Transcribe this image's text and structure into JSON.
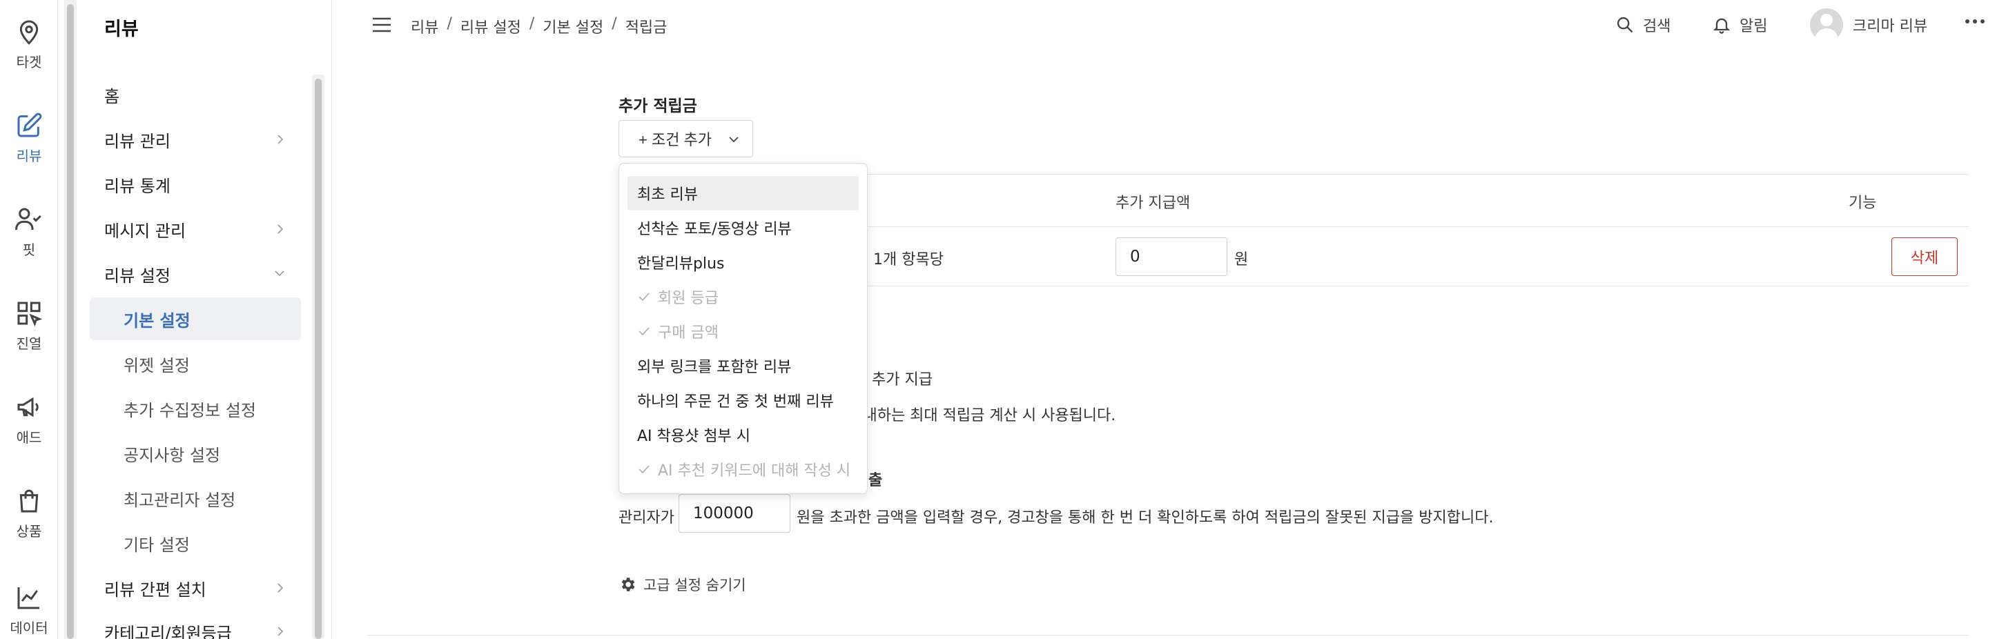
{
  "app": {
    "title": "리뷰"
  },
  "rail": {
    "items": [
      {
        "name": "target",
        "label": "타겟",
        "icon": "location-pin-icon"
      },
      {
        "name": "review",
        "label": "리뷰",
        "icon": "edit-icon",
        "active": true
      },
      {
        "name": "fit",
        "label": "핏",
        "icon": "user-check-icon"
      },
      {
        "name": "display",
        "label": "진열",
        "icon": "grid-cursor-icon"
      },
      {
        "name": "ad",
        "label": "애드",
        "icon": "megaphone-icon"
      },
      {
        "name": "product",
        "label": "상품",
        "icon": "shopping-bag-icon"
      },
      {
        "name": "data",
        "label": "데이터",
        "icon": "chart-line-icon"
      }
    ]
  },
  "menu": {
    "title": "리뷰",
    "items": [
      {
        "label": "홈"
      },
      {
        "label": "리뷰 관리"
      },
      {
        "label": "리뷰 통계"
      },
      {
        "label": "메시지 관리"
      },
      {
        "label": "리뷰 설정"
      },
      {
        "label": "기본 설정"
      },
      {
        "label": "위젯 설정"
      },
      {
        "label": "추가 수집정보 설정"
      },
      {
        "label": "공지사항 설정"
      },
      {
        "label": "최고관리자 설정"
      },
      {
        "label": "기타 설정"
      },
      {
        "label": "리뷰 간편 설치"
      },
      {
        "label": "카테고리/회원등급"
      }
    ]
  },
  "header": {
    "breadcrumb": [
      "리뷰",
      "리뷰 설정",
      "기본 설정",
      "적립금"
    ],
    "search_label": "검색",
    "alarm_label": "알림",
    "user_label": "크리마 리뷰"
  },
  "main": {
    "section_title": "추가 적립금",
    "add_condition_label": "+ 조건 추가",
    "table": {
      "headers": {
        "amount": "추가 지급액",
        "action": "기능"
      },
      "row": {
        "unit_text": "1개 항목당",
        "amount_value": "0",
        "currency": "원",
        "delete_label": "삭제"
      }
    },
    "line_extra_pay": "추가 지급",
    "line_max_calc": "에 안내하는 최대 적립금 계산 시 사용됩니다.",
    "partial_heading_tail": "출",
    "limit": {
      "prefix": "관리자가",
      "value": "100000",
      "suffix": "원을 초과한 금액을 입력할 경우, 경고창을 통해 한 번 더 확인하도록 하여 적립금의 잘못된 지급을 방지합니다."
    },
    "advanced_toggle_label": "고급 설정 숨기기"
  },
  "dropdown": {
    "items": [
      {
        "label": "최초 리뷰",
        "disabled": false,
        "hover": true
      },
      {
        "label": "선착순 포토/동영상 리뷰",
        "disabled": false
      },
      {
        "label": "한달리뷰plus",
        "disabled": false
      },
      {
        "label": "회원 등급",
        "disabled": true
      },
      {
        "label": "구매 금액",
        "disabled": true
      },
      {
        "label": "외부 링크를 포함한 리뷰",
        "disabled": false
      },
      {
        "label": "하나의 주문 건 중 첫 번째 리뷰",
        "disabled": false
      },
      {
        "label": "AI 착용샷 첨부 시",
        "disabled": false
      },
      {
        "label": "AI 추천 키워드에 대해 작성 시",
        "disabled": true
      }
    ]
  },
  "colors": {
    "accent": "#3a6fb7",
    "danger": "#c0392b",
    "selected_bg": "#eef0f4"
  }
}
